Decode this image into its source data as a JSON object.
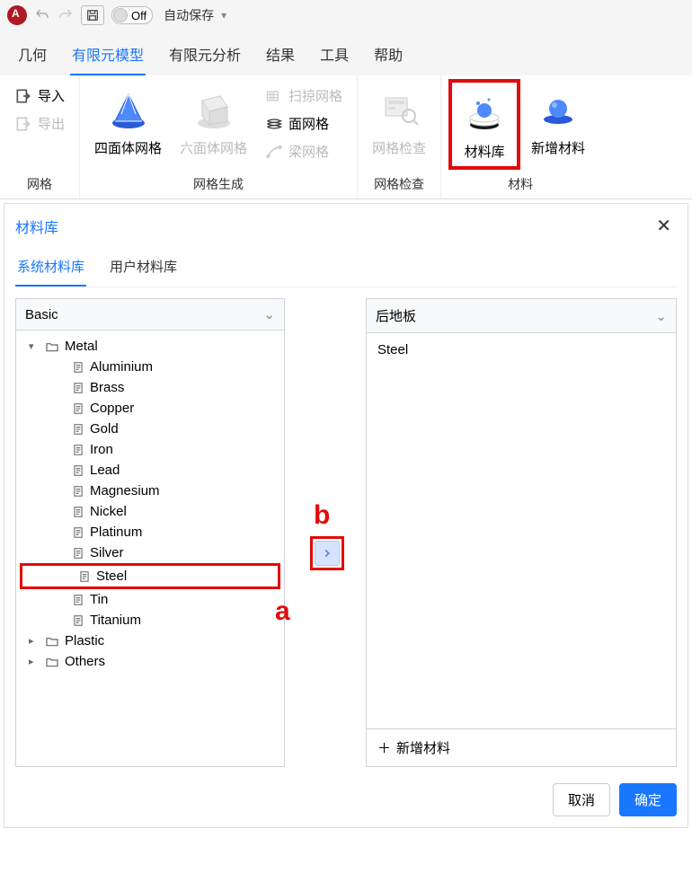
{
  "topbar": {
    "toggle_state": "Off",
    "autosave_label": "自动保存"
  },
  "menu": {
    "items": [
      "几何",
      "有限元模型",
      "有限元分析",
      "结果",
      "工具",
      "帮助"
    ],
    "active_index": 1
  },
  "ribbon": {
    "sec0": {
      "label": "网格",
      "import": "导入",
      "export": "导出"
    },
    "sec1": {
      "label": "网格生成",
      "tetra": "四面体网格",
      "hexa": "六面体网格",
      "sweep": "扫掠网格",
      "surface": "面网格",
      "beam": "梁网格"
    },
    "sec2": {
      "label": "网格检查",
      "check": "网格检查"
    },
    "sec3": {
      "label": "材料",
      "lib": "材料库",
      "add": "新增材料"
    }
  },
  "dialog": {
    "title": "材料库",
    "tabs": [
      "系统材料库",
      "用户材料库"
    ],
    "left_select": "Basic",
    "right_select": "后地板",
    "tree": {
      "metal_label": "Metal",
      "metals": [
        "Aluminium",
        "Brass",
        "Copper",
        "Gold",
        "Iron",
        "Lead",
        "Magnesium",
        "Nickel",
        "Platinum",
        "Silver",
        "Steel",
        "Tin",
        "Titanium"
      ],
      "plastic_label": "Plastic",
      "others_label": "Others"
    },
    "right_item": "Steel",
    "add_material": "新增材料",
    "cancel": "取消",
    "confirm": "确定"
  },
  "annotations": {
    "a": "a",
    "b": "b"
  }
}
